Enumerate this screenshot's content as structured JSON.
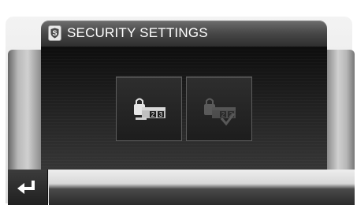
{
  "header": {
    "title": "SECURITY SETTINGS",
    "icon": "shield-s-icon"
  },
  "tiles": [
    {
      "name": "pin-code-settings",
      "icon": "lock-pin-icon",
      "enabled": true
    },
    {
      "name": "pin-verify-settings",
      "icon": "lock-pin-check-icon",
      "enabled": false
    }
  ],
  "footer": {
    "back_icon": "return-arrow-icon"
  },
  "colors": {
    "header_text": "#ffffff",
    "content_bg": "#1c1c1c",
    "tile_bg": "#262626"
  }
}
